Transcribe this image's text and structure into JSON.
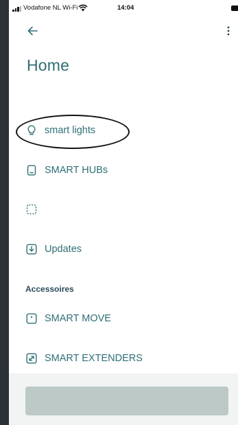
{
  "status_bar": {
    "carrier": "Vodafone NL Wi-Fi",
    "time": "14:04",
    "icons": [
      "signal-icon",
      "wifi-icon",
      "battery-icon"
    ]
  },
  "header": {
    "back_icon": "arrow-left-icon",
    "more_icon": "more-vertical-icon",
    "title": "Home"
  },
  "menu": {
    "items": [
      {
        "label": "smart lights",
        "icon": "lightbulb-icon"
      },
      {
        "label": "SMART HUBs",
        "icon": "hub-device-icon"
      },
      {
        "label": "",
        "icon": "dashed-square-icon"
      },
      {
        "label": "Updates",
        "icon": "download-box-icon"
      }
    ]
  },
  "accessories": {
    "title": "Accessoires",
    "items": [
      {
        "label": "SMART MOVE",
        "icon": "motion-sensor-icon"
      },
      {
        "label": "SMART EXTENDERS",
        "icon": "extender-icon"
      }
    ]
  },
  "bottom_button": {
    "label": ""
  },
  "colors": {
    "accent": "#2e6f75",
    "section_title": "#2b4a5a",
    "button_disabled": "#bcc9c7",
    "frame": "#2b3137"
  }
}
